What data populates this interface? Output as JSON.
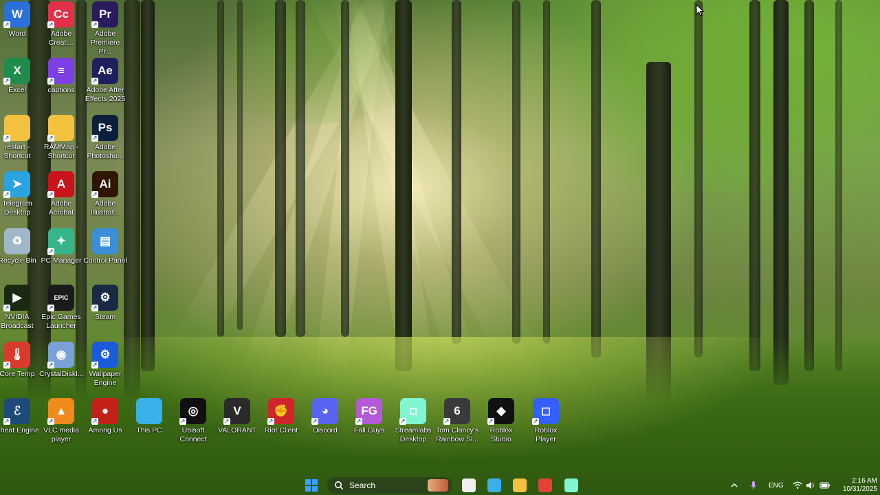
{
  "desktop_icons": [
    {
      "label": "Word",
      "icon": "word-icon",
      "color": "#2b6fd8",
      "glyph": "W"
    },
    {
      "label": "Adobe Creati...",
      "icon": "adobe-creative-cloud-icon",
      "color": "#e0304a",
      "glyph": "Cc"
    },
    {
      "label": "Adobe Premiere Pr...",
      "icon": "premiere-pro-icon",
      "color": "#2a1a5e",
      "glyph": "Pr"
    },
    {
      "label": "Excel",
      "icon": "excel-icon",
      "color": "#1f8b4c",
      "glyph": "X"
    },
    {
      "label": "captions",
      "icon": "captions-icon",
      "color": "#7b3fe4",
      "glyph": "≡"
    },
    {
      "label": "Adobe After Effects 2025",
      "icon": "after-effects-icon",
      "color": "#1f1f5e",
      "glyph": "Ae"
    },
    {
      "label": "restart - Shortcut",
      "icon": "folder-icon",
      "color": "#f2c23e",
      "glyph": ""
    },
    {
      "label": "RAMMap - Shortcut",
      "icon": "folder-icon",
      "color": "#f2c23e",
      "glyph": ""
    },
    {
      "label": "Adobe Photosho...",
      "icon": "photoshop-icon",
      "color": "#0a1f3a",
      "glyph": "Ps"
    },
    {
      "label": "Telegram Desktop",
      "icon": "telegram-icon",
      "color": "#2aa3e0",
      "glyph": "➤"
    },
    {
      "label": "Adobe Acrobat",
      "icon": "acrobat-icon",
      "color": "#c8141a",
      "glyph": "A"
    },
    {
      "label": "Adobe Illustrat...",
      "icon": "illustrator-icon",
      "color": "#2e1600",
      "glyph": "Ai"
    },
    {
      "label": "Recycle Bin",
      "icon": "recycle-bin-icon",
      "color": "#9fb7c8",
      "glyph": "♻"
    },
    {
      "label": "PC Manager",
      "icon": "pc-manager-icon",
      "color": "#38b48a",
      "glyph": "✦"
    },
    {
      "label": "Control Panel",
      "icon": "control-panel-icon",
      "color": "#3a8fd8",
      "glyph": "▤"
    },
    {
      "label": "NVIDIA Broadcast",
      "icon": "nvidia-broadcast-icon",
      "color": "#1a2a12",
      "glyph": "▶"
    },
    {
      "label": "Epic Games Launcher",
      "icon": "epic-games-icon",
      "color": "#1b1b1b",
      "glyph": "EPIC"
    },
    {
      "label": "Steam",
      "icon": "steam-icon",
      "color": "#1a2a44",
      "glyph": "⚙"
    },
    {
      "label": "Core Temp",
      "icon": "core-temp-icon",
      "color": "#d83b2b",
      "glyph": "🌡"
    },
    {
      "label": "CrystalDiskI...",
      "icon": "crystaldiskinfo-icon",
      "color": "#7aa0d8",
      "glyph": "◉"
    },
    {
      "label": "Wallpaper Engine",
      "icon": "wallpaper-engine-icon",
      "color": "#1c5bd8",
      "glyph": "⚙"
    },
    {
      "label": "Cheat Engine",
      "icon": "cheat-engine-icon",
      "color": "#1e4a7a",
      "glyph": "ℰ"
    },
    {
      "label": "VLC media player",
      "icon": "vlc-icon",
      "color": "#f08a1a",
      "glyph": "▲"
    },
    {
      "label": "Among Us",
      "icon": "among-us-icon",
      "color": "#c4201a",
      "glyph": "●"
    },
    {
      "label": "This PC",
      "icon": "this-pc-icon",
      "color": "#3ab0e8",
      "glyph": ""
    },
    {
      "label": "Ubisoft Connect",
      "icon": "ubisoft-icon",
      "color": "#101010",
      "glyph": "◎"
    },
    {
      "label": "VALORANT",
      "icon": "valorant-icon",
      "color": "#2a2a2a",
      "glyph": "V"
    },
    {
      "label": "Riot Client",
      "icon": "riot-client-icon",
      "color": "#d0252a",
      "glyph": "✊"
    },
    {
      "label": "Discord",
      "icon": "discord-icon",
      "color": "#5865f2",
      "glyph": "◕"
    },
    {
      "label": "Fall Guys",
      "icon": "fall-guys-icon",
      "color": "#b45ad8",
      "glyph": "FG"
    },
    {
      "label": "Streamlabs Desktop",
      "icon": "streamlabs-icon",
      "color": "#80f5d2",
      "glyph": "◘"
    },
    {
      "label": "Tom Clancy's Rainbow Si...",
      "icon": "rainbow-six-icon",
      "color": "#3a3a3a",
      "glyph": "6"
    },
    {
      "label": "Roblox Studio",
      "icon": "roblox-studio-icon",
      "color": "#111111",
      "glyph": "◆"
    },
    {
      "label": "Roblox Player",
      "icon": "roblox-player-icon",
      "color": "#335fff",
      "glyph": "◻"
    }
  ],
  "taskbar": {
    "search_placeholder": "Search",
    "pinned": [
      {
        "icon": "microsoft-store-icon",
        "color": "#f0f0f0"
      },
      {
        "icon": "desktop-icon",
        "color": "#3ab0e8"
      },
      {
        "icon": "file-explorer-icon",
        "color": "#f2c23e"
      },
      {
        "icon": "chrome-icon",
        "color": "#e34234"
      },
      {
        "icon": "streamlabs-icon",
        "color": "#80f5d2"
      }
    ],
    "tray": {
      "language": "ENG",
      "time": "2:16 AM",
      "date": "10/31/2025"
    }
  }
}
